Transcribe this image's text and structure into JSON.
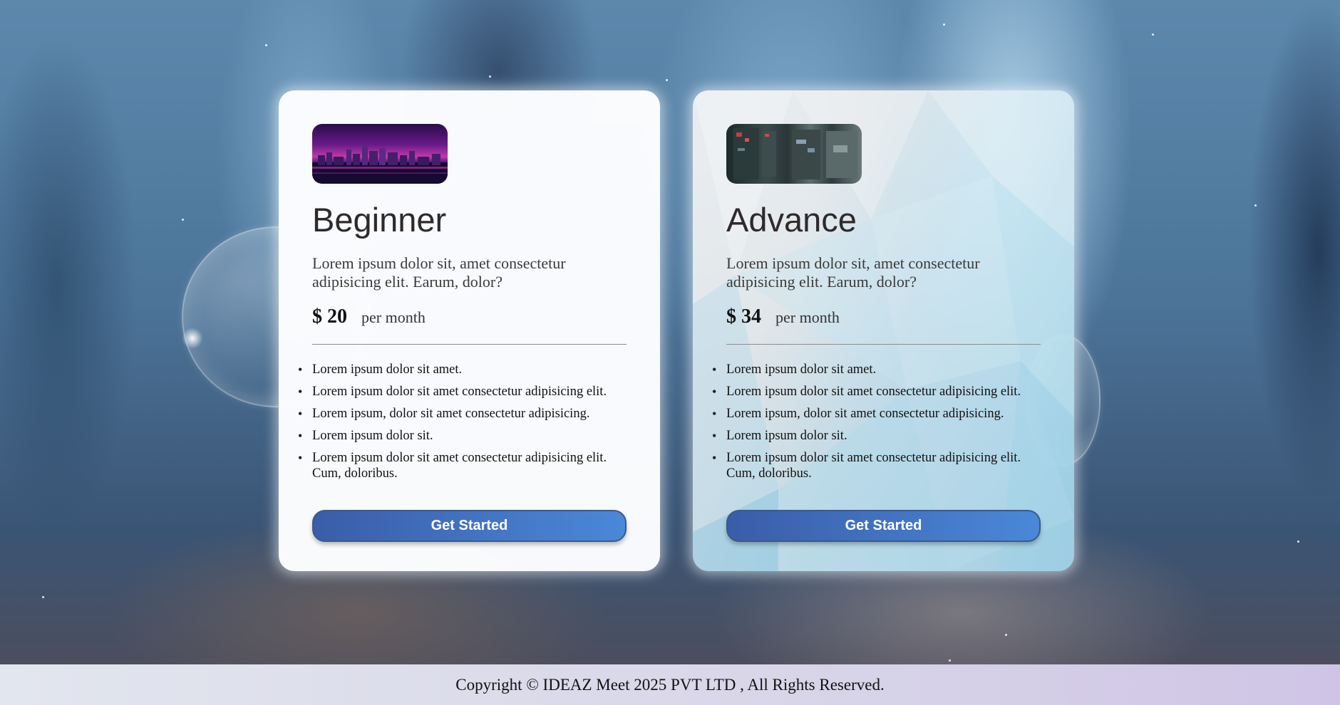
{
  "plans": [
    {
      "title": "Beginner",
      "description": "Lorem ipsum dolor sit, amet consectetur adipisicing elit. Earum, dolor?",
      "price": "$ 20",
      "period": "per month",
      "features": [
        "Lorem ipsum dolor sit amet.",
        "Lorem ipsum dolor sit amet consectetur adipisicing elit.",
        "Lorem ipsum, dolor sit amet consectetur adipisicing.",
        "Lorem ipsum dolor sit.",
        "Lorem ipsum dolor sit amet consectetur adipisicing elit. Cum, doloribus."
      ],
      "cta_label": "Get Started",
      "image": "city-skyline-image"
    },
    {
      "title": "Advance",
      "description": "Lorem ipsum dolor sit, amet consectetur adipisicing elit. Earum, dolor?",
      "price": "$ 34",
      "period": "per month",
      "features": [
        "Lorem ipsum dolor sit amet.",
        "Lorem ipsum dolor sit amet consectetur adipisicing elit.",
        "Lorem ipsum, dolor sit amet consectetur adipisicing.",
        "Lorem ipsum dolor sit.",
        "Lorem ipsum dolor sit amet consectetur adipisicing elit. Cum, doloribus."
      ],
      "cta_label": "Get Started",
      "image": "server-rack-image"
    }
  ],
  "footer": {
    "copyright": "Copyright © IDEAZ Meet 2025 PVT LTD , All Rights Reserved."
  },
  "colors": {
    "button_start": "#3a5da8",
    "button_end": "#4a88d8",
    "footer_start": "#e2e6ee",
    "footer_end": "#cfc4e6"
  }
}
